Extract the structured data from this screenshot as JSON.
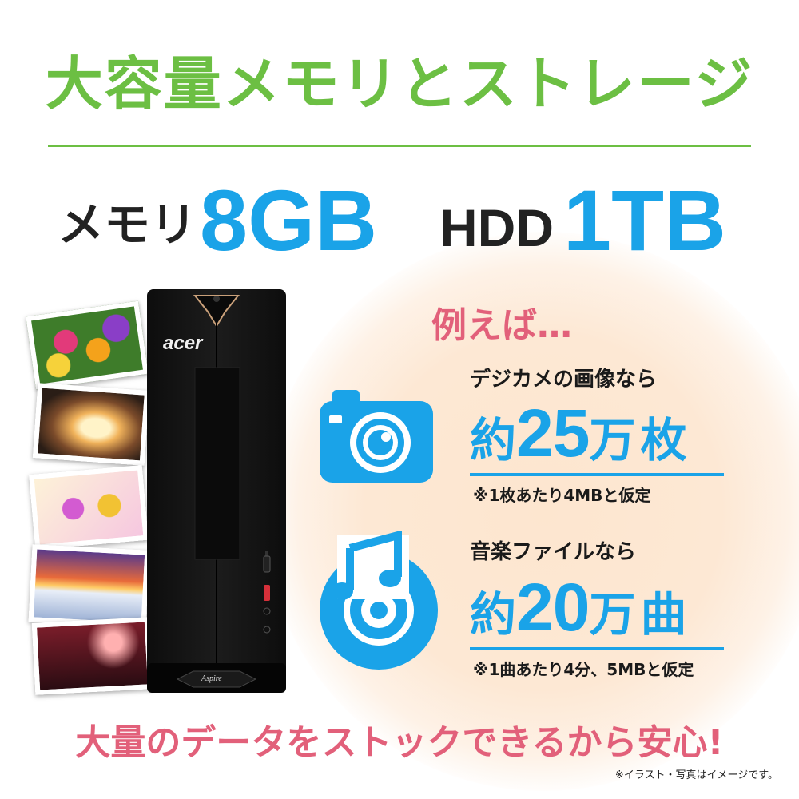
{
  "headline": "大容量メモリとストレージ",
  "specs": {
    "memory_label": "メモリ",
    "memory_value": "8GB",
    "storage_label": "HDD",
    "storage_value": "1TB"
  },
  "pc": {
    "brand": "acer",
    "model": "Aspire"
  },
  "example_label": "例えば…",
  "photo_example": {
    "caption": "デジカメの画像なら",
    "prefix": "約",
    "number": "25",
    "suffix": "万枚",
    "note": "※1枚あたり4MBと仮定"
  },
  "music_example": {
    "caption": "音楽ファイルなら",
    "prefix": "約",
    "number": "20",
    "suffix": "万曲",
    "note": "※1曲あたり4分、5MBと仮定"
  },
  "footer": "大量のデータをストックできるから安心!",
  "disclaimer": "※イラスト・写真はイメージです。",
  "colors": {
    "green": "#6cbf43",
    "blue": "#1aa3e8",
    "pink": "#e2607a",
    "glow": "#fde6cf"
  },
  "icons": [
    "camera-icon",
    "music-cd-icon"
  ]
}
